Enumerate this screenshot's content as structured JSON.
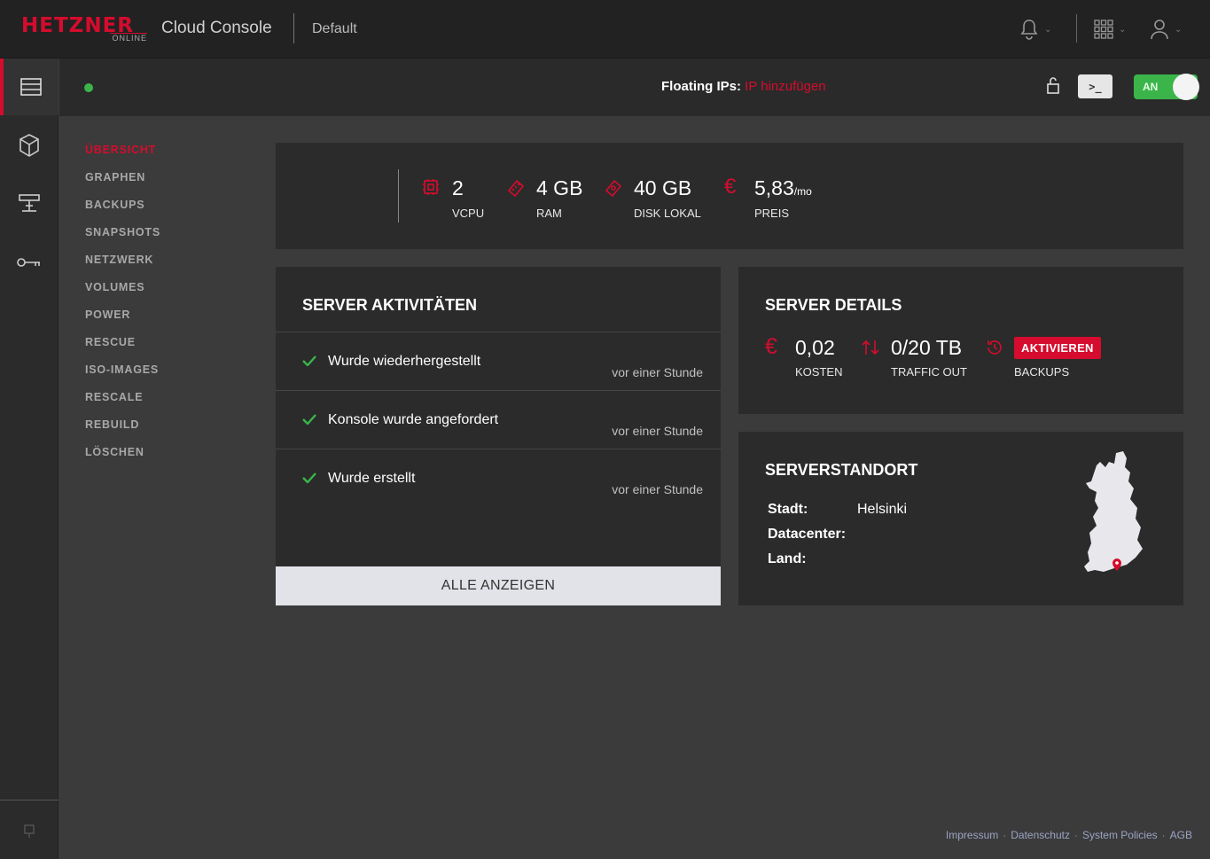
{
  "header": {
    "logo_text": "HETZNER",
    "logo_sub": "ONLINE",
    "app_title": "Cloud Console",
    "project": "Default"
  },
  "server": {
    "status_color": "#3bb54a",
    "floating_label": "Floating IPs:",
    "floating_link": "IP hinzufügen",
    "power_label": "AN"
  },
  "subnav": [
    "ÜBERSICHT",
    "GRAPHEN",
    "BACKUPS",
    "SNAPSHOTS",
    "NETZWERK",
    "VOLUMES",
    "POWER",
    "RESCUE",
    "ISO-IMAGES",
    "RESCALE",
    "REBUILD",
    "LÖSCHEN"
  ],
  "specs": {
    "vcpu": {
      "value": "2",
      "label": "VCPU"
    },
    "ram": {
      "value": "4 GB",
      "label": "RAM"
    },
    "disk": {
      "value": "40 GB",
      "label": "DISK LOKAL"
    },
    "price": {
      "value": "5,83",
      "unit": "/mo",
      "label": "PREIS"
    }
  },
  "activities": {
    "title": "SERVER AKTIVITÄTEN",
    "items": [
      {
        "text": "Wurde wiederhergestellt",
        "time": "vor einer Stunde"
      },
      {
        "text": "Konsole wurde angefordert",
        "time": "vor einer Stunde"
      },
      {
        "text": "Wurde erstellt",
        "time": "vor einer Stunde"
      }
    ],
    "show_all": "ALLE ANZEIGEN"
  },
  "details": {
    "title": "SERVER DETAILS",
    "cost": {
      "value": "0,02",
      "label": "KOSTEN"
    },
    "traffic": {
      "value": "0/20 TB",
      "label": "TRAFFIC OUT"
    },
    "backups": {
      "button": "AKTIVIEREN",
      "label": "BACKUPS"
    }
  },
  "location": {
    "title": "SERVERSTANDORT",
    "city_label": "Stadt:",
    "city": "Helsinki",
    "dc_label": "Datacenter:",
    "country_label": "Land:"
  },
  "footer": [
    "Impressum",
    "Datenschutz",
    "System Policies",
    "AGB"
  ],
  "colors": {
    "accent": "#d50c2d",
    "success": "#3bb54a"
  }
}
